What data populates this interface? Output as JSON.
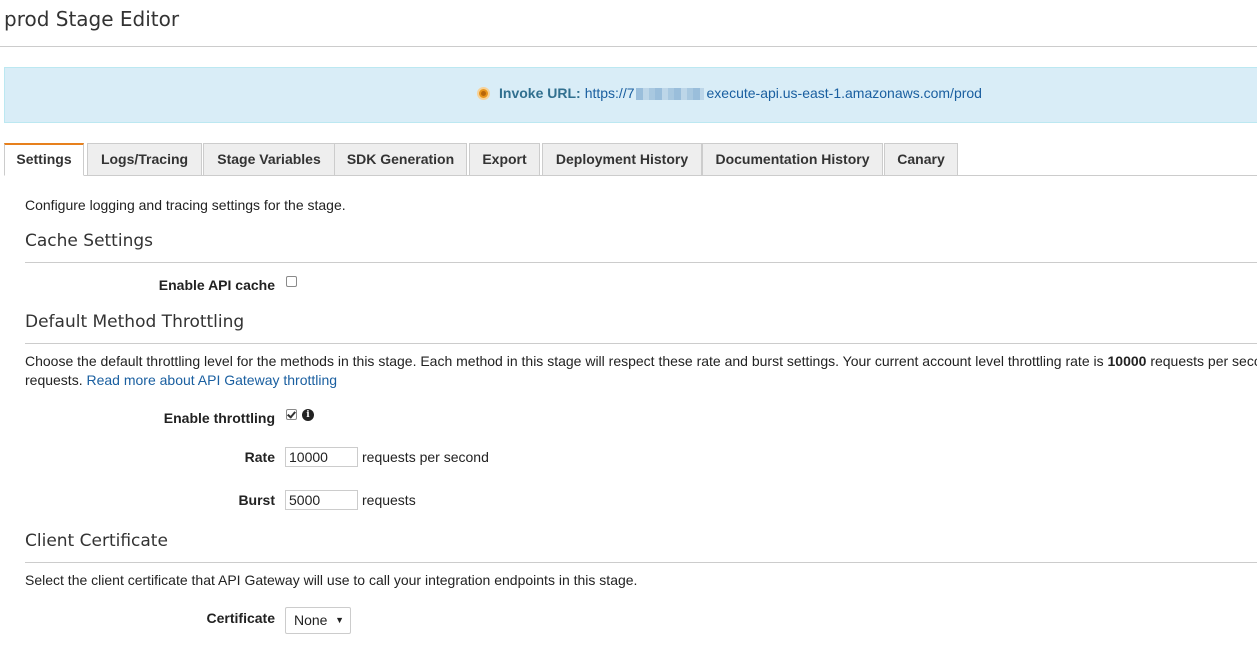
{
  "header": {
    "title": "prod Stage Editor"
  },
  "invoke": {
    "label": "Invoke URL:",
    "url_prefix": "https://7",
    "url_suffix": "execute-api.us-east-1.amazonaws.com/prod"
  },
  "tabs": [
    {
      "label": "Settings",
      "active": true
    },
    {
      "label": "Logs/Tracing"
    },
    {
      "label": "Stage Variables"
    },
    {
      "label": "SDK Generation"
    },
    {
      "label": "Export"
    },
    {
      "label": "Deployment History"
    },
    {
      "label": "Documentation History"
    },
    {
      "label": "Canary"
    }
  ],
  "intro": "Configure logging and tracing settings for the stage.",
  "cache": {
    "heading": "Cache Settings",
    "enable_label": "Enable API cache",
    "enabled": false
  },
  "throttling": {
    "heading": "Default Method Throttling",
    "description_pre": "Choose the default throttling level for the methods in this stage. Each method in this stage will respect these rate and burst settings. Your current account level throttling rate is ",
    "account_rate": "10000",
    "description_post": " requests per second",
    "description_line2": "requests. ",
    "read_more": "Read more about API Gateway throttling",
    "enable_label": "Enable throttling",
    "enabled": true,
    "rate_label": "Rate",
    "rate_value": "10000",
    "rate_suffix": "requests per second",
    "burst_label": "Burst",
    "burst_value": "5000",
    "burst_suffix": "requests"
  },
  "certificate": {
    "heading": "Client Certificate",
    "description": "Select the client certificate that API Gateway will use to call your integration endpoints in this stage.",
    "label": "Certificate",
    "selected": "None"
  },
  "icons": {
    "status": "status-dot-icon",
    "info": "info-icon",
    "dropdown": "caret-down-icon"
  },
  "colors": {
    "accent_tab": "#e7801d",
    "banner_bg": "#d9edf7",
    "link": "#1a5fa0",
    "status": "#e8941a"
  }
}
